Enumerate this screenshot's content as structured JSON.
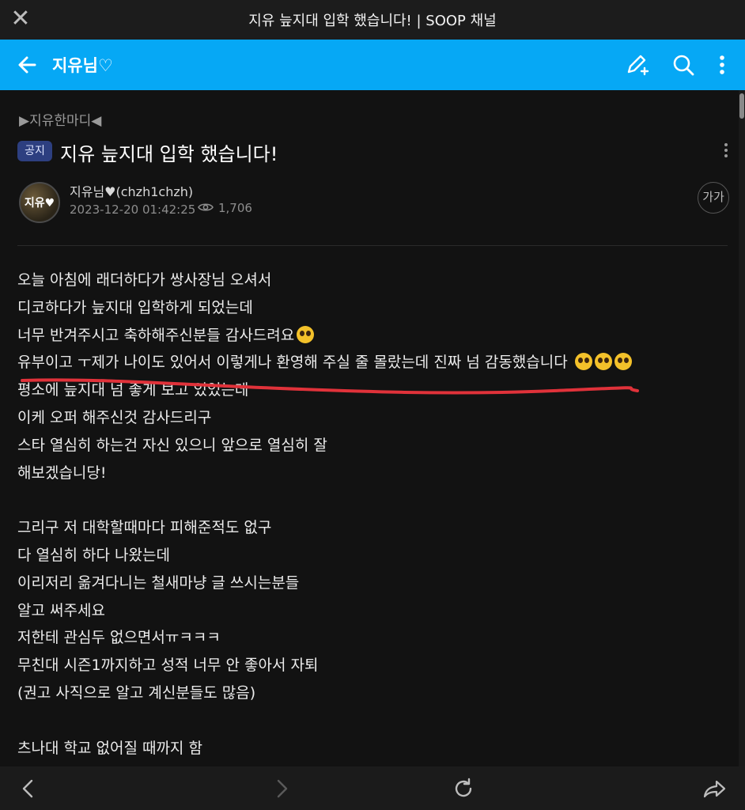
{
  "window": {
    "title": "지유 늪지대 입학 했습니다! | SOOP 채널",
    "close_icon": "close-icon"
  },
  "app_header": {
    "channel_name": "지유님♡",
    "background_color": "#06a8f5",
    "icons": [
      "back-arrow-icon",
      "write-post-icon",
      "search-icon",
      "more-vertical-icon"
    ]
  },
  "post": {
    "category": "▶지유한마디◀",
    "badge": "공지",
    "title": "지유 늪지대 입학 했습니다!",
    "author": "지유님♥(chzh1chzh)",
    "avatar_text": "지유♥",
    "date": "2023-12-20 01:42:25",
    "views": "1,706",
    "font_size_label": "가가",
    "body": [
      "오늘 아침에 래더하다가 쌍사장님 오셔서",
      "디코하다가 늪지대 입학하게 되었는데",
      "너무 반겨주시고 축하해주신분들 감사드려요",
      "유부이고 ㅜ제가 나이도 있어서 이렇게나 환영해 주실 줄 몰랐는데 진짜 넘 감동했습니다",
      "평소에 늪지대 넘 좋게 보고 있었는데",
      "이케 오퍼 해주신것 감사드리구",
      "스타 열심히 하는건 자신 있으니 앞으로 열심히 잘",
      "해보겠습니당!",
      "",
      "그리구 저 대학할때마다 피해준적도 없구",
      "다 열심히 하다 나왔는데",
      "이리저리 옮겨다니는 철새마냥 글 쓰시는분들",
      "알고 써주세요",
      "저한테 관심두 없으면서ㅠㅋㅋㅋ",
      "무친대 시즌1까지하고 성적 너무 안 좋아서 자퇴",
      "(권고 사직으로 알고 계신분들도 많음)",
      "",
      "츠나대 학교 없어질 때까지 함"
    ],
    "annotation_color": "#e0323a"
  },
  "bottom_nav": {
    "icons": [
      "back-icon",
      "forward-icon",
      "refresh-icon",
      "share-icon"
    ]
  }
}
